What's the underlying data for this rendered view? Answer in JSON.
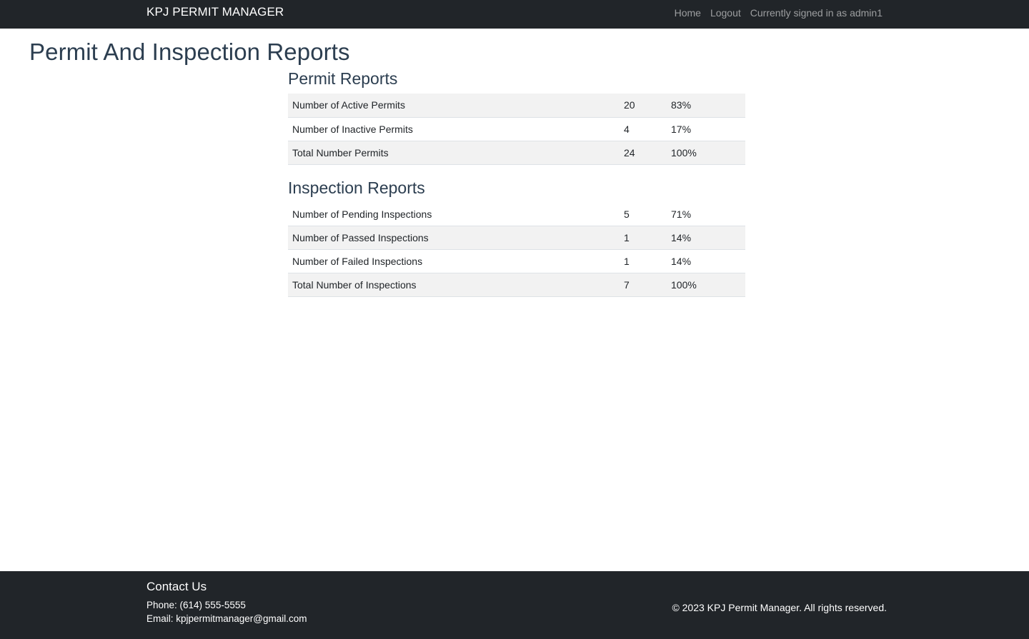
{
  "navbar": {
    "brand": "KPJ PERMIT MANAGER",
    "links": {
      "home": "Home",
      "logout": "Logout"
    },
    "signed_in_text": "Currently signed in as admin1"
  },
  "page_title": "Permit And Inspection Reports",
  "permit_reports": {
    "title": "Permit Reports",
    "rows": [
      {
        "label": "Number of Active Permits",
        "count": "20",
        "percent": "83%"
      },
      {
        "label": "Number of Inactive Permits",
        "count": "4",
        "percent": "17%"
      },
      {
        "label": "Total Number Permits",
        "count": "24",
        "percent": "100%"
      }
    ]
  },
  "inspection_reports": {
    "title": "Inspection Reports",
    "rows": [
      {
        "label": "Number of Pending Inspections",
        "count": "5",
        "percent": "71%"
      },
      {
        "label": "Number of Passed Inspections",
        "count": "1",
        "percent": "14%"
      },
      {
        "label": "Number of Failed Inspections",
        "count": "1",
        "percent": "14%"
      },
      {
        "label": "Total Number of Inspections",
        "count": "7",
        "percent": "100%"
      }
    ]
  },
  "footer": {
    "heading": "Contact Us",
    "phone": "Phone: (614) 555-5555",
    "email": "Email: kpjpermitmanager@gmail.com",
    "copyright": "© 2023 KPJ Permit Manager. All rights reserved."
  },
  "colors": {
    "navbar_bg": "#212529",
    "heading": "#2c3e50",
    "stripe": "#f2f2f2"
  }
}
